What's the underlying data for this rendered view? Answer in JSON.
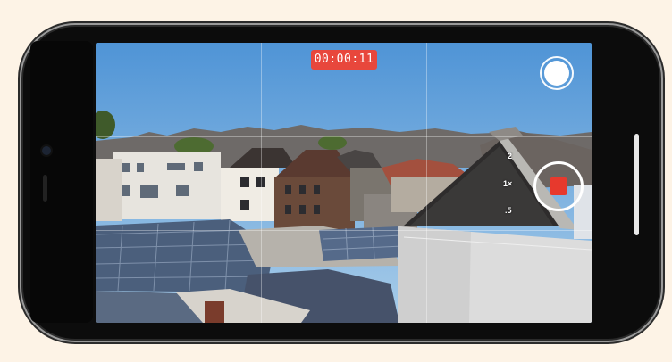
{
  "camera": {
    "timer": "00:00:11",
    "zoom_levels": [
      "2",
      "1×",
      ".5"
    ]
  },
  "colors": {
    "record_red": "#e7392d",
    "timer_bg": "#e8473c"
  },
  "icons": [
    "shutter-icon",
    "record-stop-icon"
  ]
}
